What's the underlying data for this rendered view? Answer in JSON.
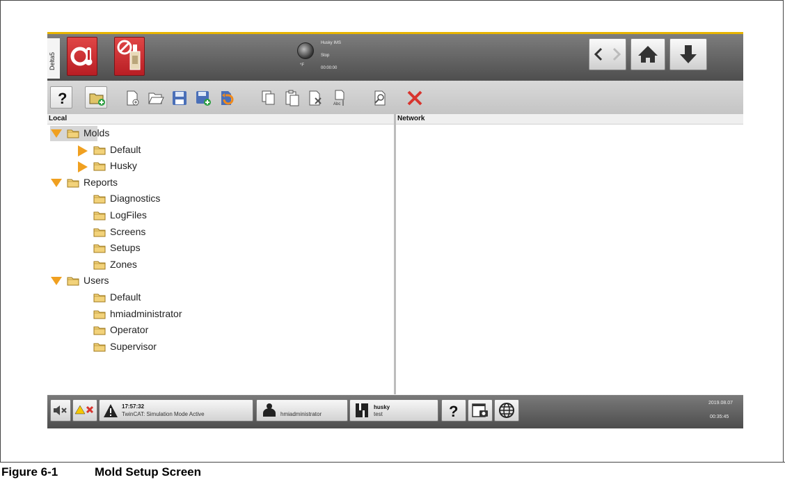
{
  "figure": {
    "number": "Figure 6-1",
    "title": "Mold Setup Screen"
  },
  "header": {
    "side_tab": "Delta5",
    "status": {
      "name": "Husky IMS",
      "state": "Stop",
      "unit": "°F",
      "timer": "00:00:00"
    }
  },
  "panes": {
    "local_label": "Local",
    "network_label": "Network"
  },
  "tree": [
    {
      "label": "Molds",
      "expanded": true
    },
    {
      "label": "Default",
      "expanded": false
    },
    {
      "label": "Husky",
      "expanded": false
    },
    {
      "label": "Reports",
      "expanded": true
    },
    {
      "label": "Diagnostics"
    },
    {
      "label": "LogFiles"
    },
    {
      "label": "Screens"
    },
    {
      "label": "Setups"
    },
    {
      "label": "Zones"
    },
    {
      "label": "Users",
      "expanded": true
    },
    {
      "label": "Default"
    },
    {
      "label": "hmiadministrator"
    },
    {
      "label": "Operator"
    },
    {
      "label": "Supervisor"
    }
  ],
  "footer": {
    "alarm_time": "17:57:32",
    "alarm_text": "TwinCAT: Simulation Mode Active",
    "user": "hmiadministrator",
    "mold_name": "husky",
    "mold_sub": "test",
    "date": "2019.08.07",
    "time": "00:35:45"
  },
  "icons": [
    "mute-icon",
    "alarm-clear-icon",
    "warning-icon",
    "user-icon",
    "mold-icon",
    "help-icon",
    "screenshot-icon",
    "globe-icon",
    "home-icon",
    "download-arrow-icon",
    "back-icon",
    "forward-icon",
    "folder-icon"
  ],
  "colors": {
    "accent": "#e7b400",
    "alarm_red": "#c8262c",
    "tree_arrow": "#f0a020",
    "folder": "#e8b84a"
  }
}
